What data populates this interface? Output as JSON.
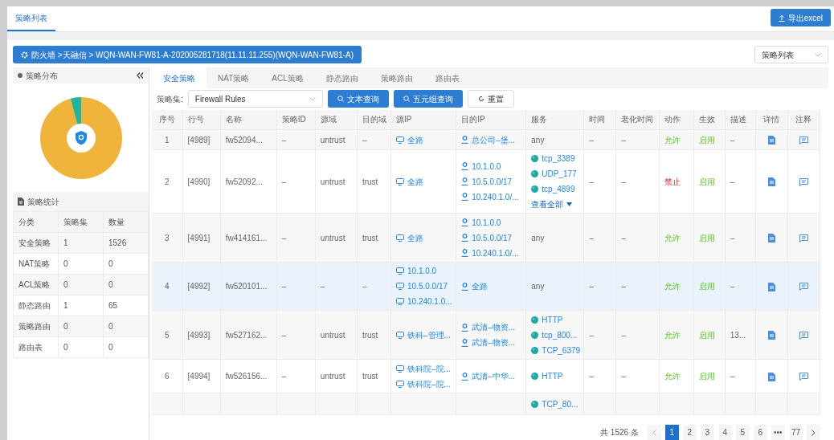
{
  "page_tab": {
    "label": "策略列表",
    "selected": true
  },
  "export_button": "导出excel",
  "breadcrumb": "防火墙 >天融信 > WQN-WAN-FW81-A-202005281718(11.11.11.255)(WQN-WAN-FW81-A)",
  "view_select": {
    "value": "策略列表"
  },
  "sidebar": {
    "distribution_title": "策略分布",
    "stats_title": "策略统计",
    "stats_columns": [
      "分类",
      "策略集",
      "数量"
    ],
    "stats_rows": [
      [
        "安全策略",
        "1",
        "1526"
      ],
      [
        "NAT策略",
        "0",
        "0"
      ],
      [
        "ACL策略",
        "0",
        "0"
      ],
      [
        "静态路由",
        "1",
        "65"
      ],
      [
        "策略路由",
        "0",
        "0"
      ],
      [
        "路由表",
        "0",
        "0"
      ]
    ]
  },
  "tabs": [
    {
      "label": "安全策略",
      "selected": true
    },
    {
      "label": "NAT策略",
      "selected": false
    },
    {
      "label": "ACL策略",
      "selected": false
    },
    {
      "label": "静态路由",
      "selected": false
    },
    {
      "label": "策略路由",
      "selected": false
    },
    {
      "label": "路由表",
      "selected": false
    }
  ],
  "filter": {
    "label": "策略集:",
    "value": "Firewall Rules",
    "buttons": [
      {
        "label": "文本查询",
        "kind": "primary"
      },
      {
        "label": "五元组查询",
        "kind": "primary"
      },
      {
        "label": "重置",
        "kind": "plain"
      }
    ]
  },
  "table": {
    "columns": [
      "序号",
      "行号",
      "名称",
      "策略ID",
      "源域",
      "目的域",
      "源IP",
      "目的IP",
      "服务",
      "时间",
      "老化时间",
      "动作",
      "生效",
      "描述",
      "详情",
      "注释"
    ],
    "rows": [
      {
        "selected": false,
        "partial": false,
        "no": "1",
        "line": "[4989]",
        "name": "fw52094...",
        "policy_id": "–",
        "src_zone": "untrust",
        "dst_zone": "–",
        "src_ip": [
          "全路"
        ],
        "dst_ip": [
          "总公司–堡..."
        ],
        "services": [],
        "service_text": "any",
        "time": "–",
        "aging": "–",
        "action": {
          "label": "允许",
          "kind": "allow"
        },
        "status": "启用",
        "desc": "–"
      },
      {
        "selected": false,
        "partial": false,
        "no": "2",
        "line": "[4990]",
        "name": "fw52092...",
        "policy_id": "–",
        "src_zone": "untrust",
        "dst_zone": "trust",
        "src_ip": [
          "全路"
        ],
        "dst_ip": [
          "10.1.0.0",
          "10.5.0.0/17",
          "10.240.1.0/..."
        ],
        "services": [
          "tcp_3389",
          "UDP_177",
          "tcp_4899"
        ],
        "more": "查看全部",
        "time": "–",
        "aging": "–",
        "action": {
          "label": "禁止",
          "kind": "deny"
        },
        "status": "启用",
        "desc": "–"
      },
      {
        "selected": false,
        "partial": false,
        "no": "3",
        "line": "[4991]",
        "name": "fw414161...",
        "policy_id": "–",
        "src_zone": "untrust",
        "dst_zone": "trust",
        "src_ip": [
          "全路"
        ],
        "dst_ip": [
          "10.1.0.0",
          "10.5.0.0/17",
          "10.240.1.0/..."
        ],
        "services": [],
        "service_text": "any",
        "time": "–",
        "aging": "–",
        "action": {
          "label": "允许",
          "kind": "allow"
        },
        "status": "启用",
        "desc": "–"
      },
      {
        "selected": true,
        "partial": false,
        "no": "4",
        "line": "[4992]",
        "name": "fw520101...",
        "policy_id": "–",
        "src_zone": "–",
        "dst_zone": "–",
        "src_ip": [
          "10.1.0.0",
          "10.5.0.0/17",
          "10.240.1.0..."
        ],
        "dst_ip": [
          "全路"
        ],
        "services": [],
        "service_text": "any",
        "time": "–",
        "aging": "–",
        "action": {
          "label": "允许",
          "kind": "allow"
        },
        "status": "启用",
        "desc": "–"
      },
      {
        "selected": false,
        "partial": false,
        "no": "5",
        "line": "[4993]",
        "name": "fw527162...",
        "policy_id": "–",
        "src_zone": "untrust",
        "dst_zone": "trust",
        "src_ip": [
          "铁科–管理..."
        ],
        "dst_ip": [
          "武清–物资...",
          "武清–物资..."
        ],
        "services": [
          "HTTP",
          "tcp_800...",
          "TCP_6379"
        ],
        "time": "–",
        "aging": "–",
        "action": {
          "label": "允许",
          "kind": "allow"
        },
        "status": "启用",
        "desc": "13..."
      },
      {
        "selected": false,
        "partial": false,
        "no": "6",
        "line": "[4994]",
        "name": "fw526156...",
        "policy_id": "–",
        "src_zone": "untrust",
        "dst_zone": "trust",
        "src_ip": [
          "铁科院–院...",
          "铁科院–院..."
        ],
        "dst_ip": [
          "武清–中华..."
        ],
        "services": [
          "HTTP"
        ],
        "time": "–",
        "aging": "–",
        "action": {
          "label": "允许",
          "kind": "allow"
        },
        "status": "启用",
        "desc": "–"
      },
      {
        "selected": false,
        "partial": true,
        "services": [
          "TCP_80..."
        ]
      }
    ]
  },
  "pagination": {
    "total": "共 1526 条",
    "pages": [
      {
        "label": "1",
        "selected": true
      },
      {
        "label": "2",
        "selected": false
      },
      {
        "label": "3",
        "selected": false
      },
      {
        "label": "4",
        "selected": false
      },
      {
        "label": "5",
        "selected": false
      },
      {
        "label": "6",
        "selected": false
      },
      {
        "label": "•••",
        "selected": false
      },
      {
        "label": "77",
        "selected": false
      }
    ]
  }
}
